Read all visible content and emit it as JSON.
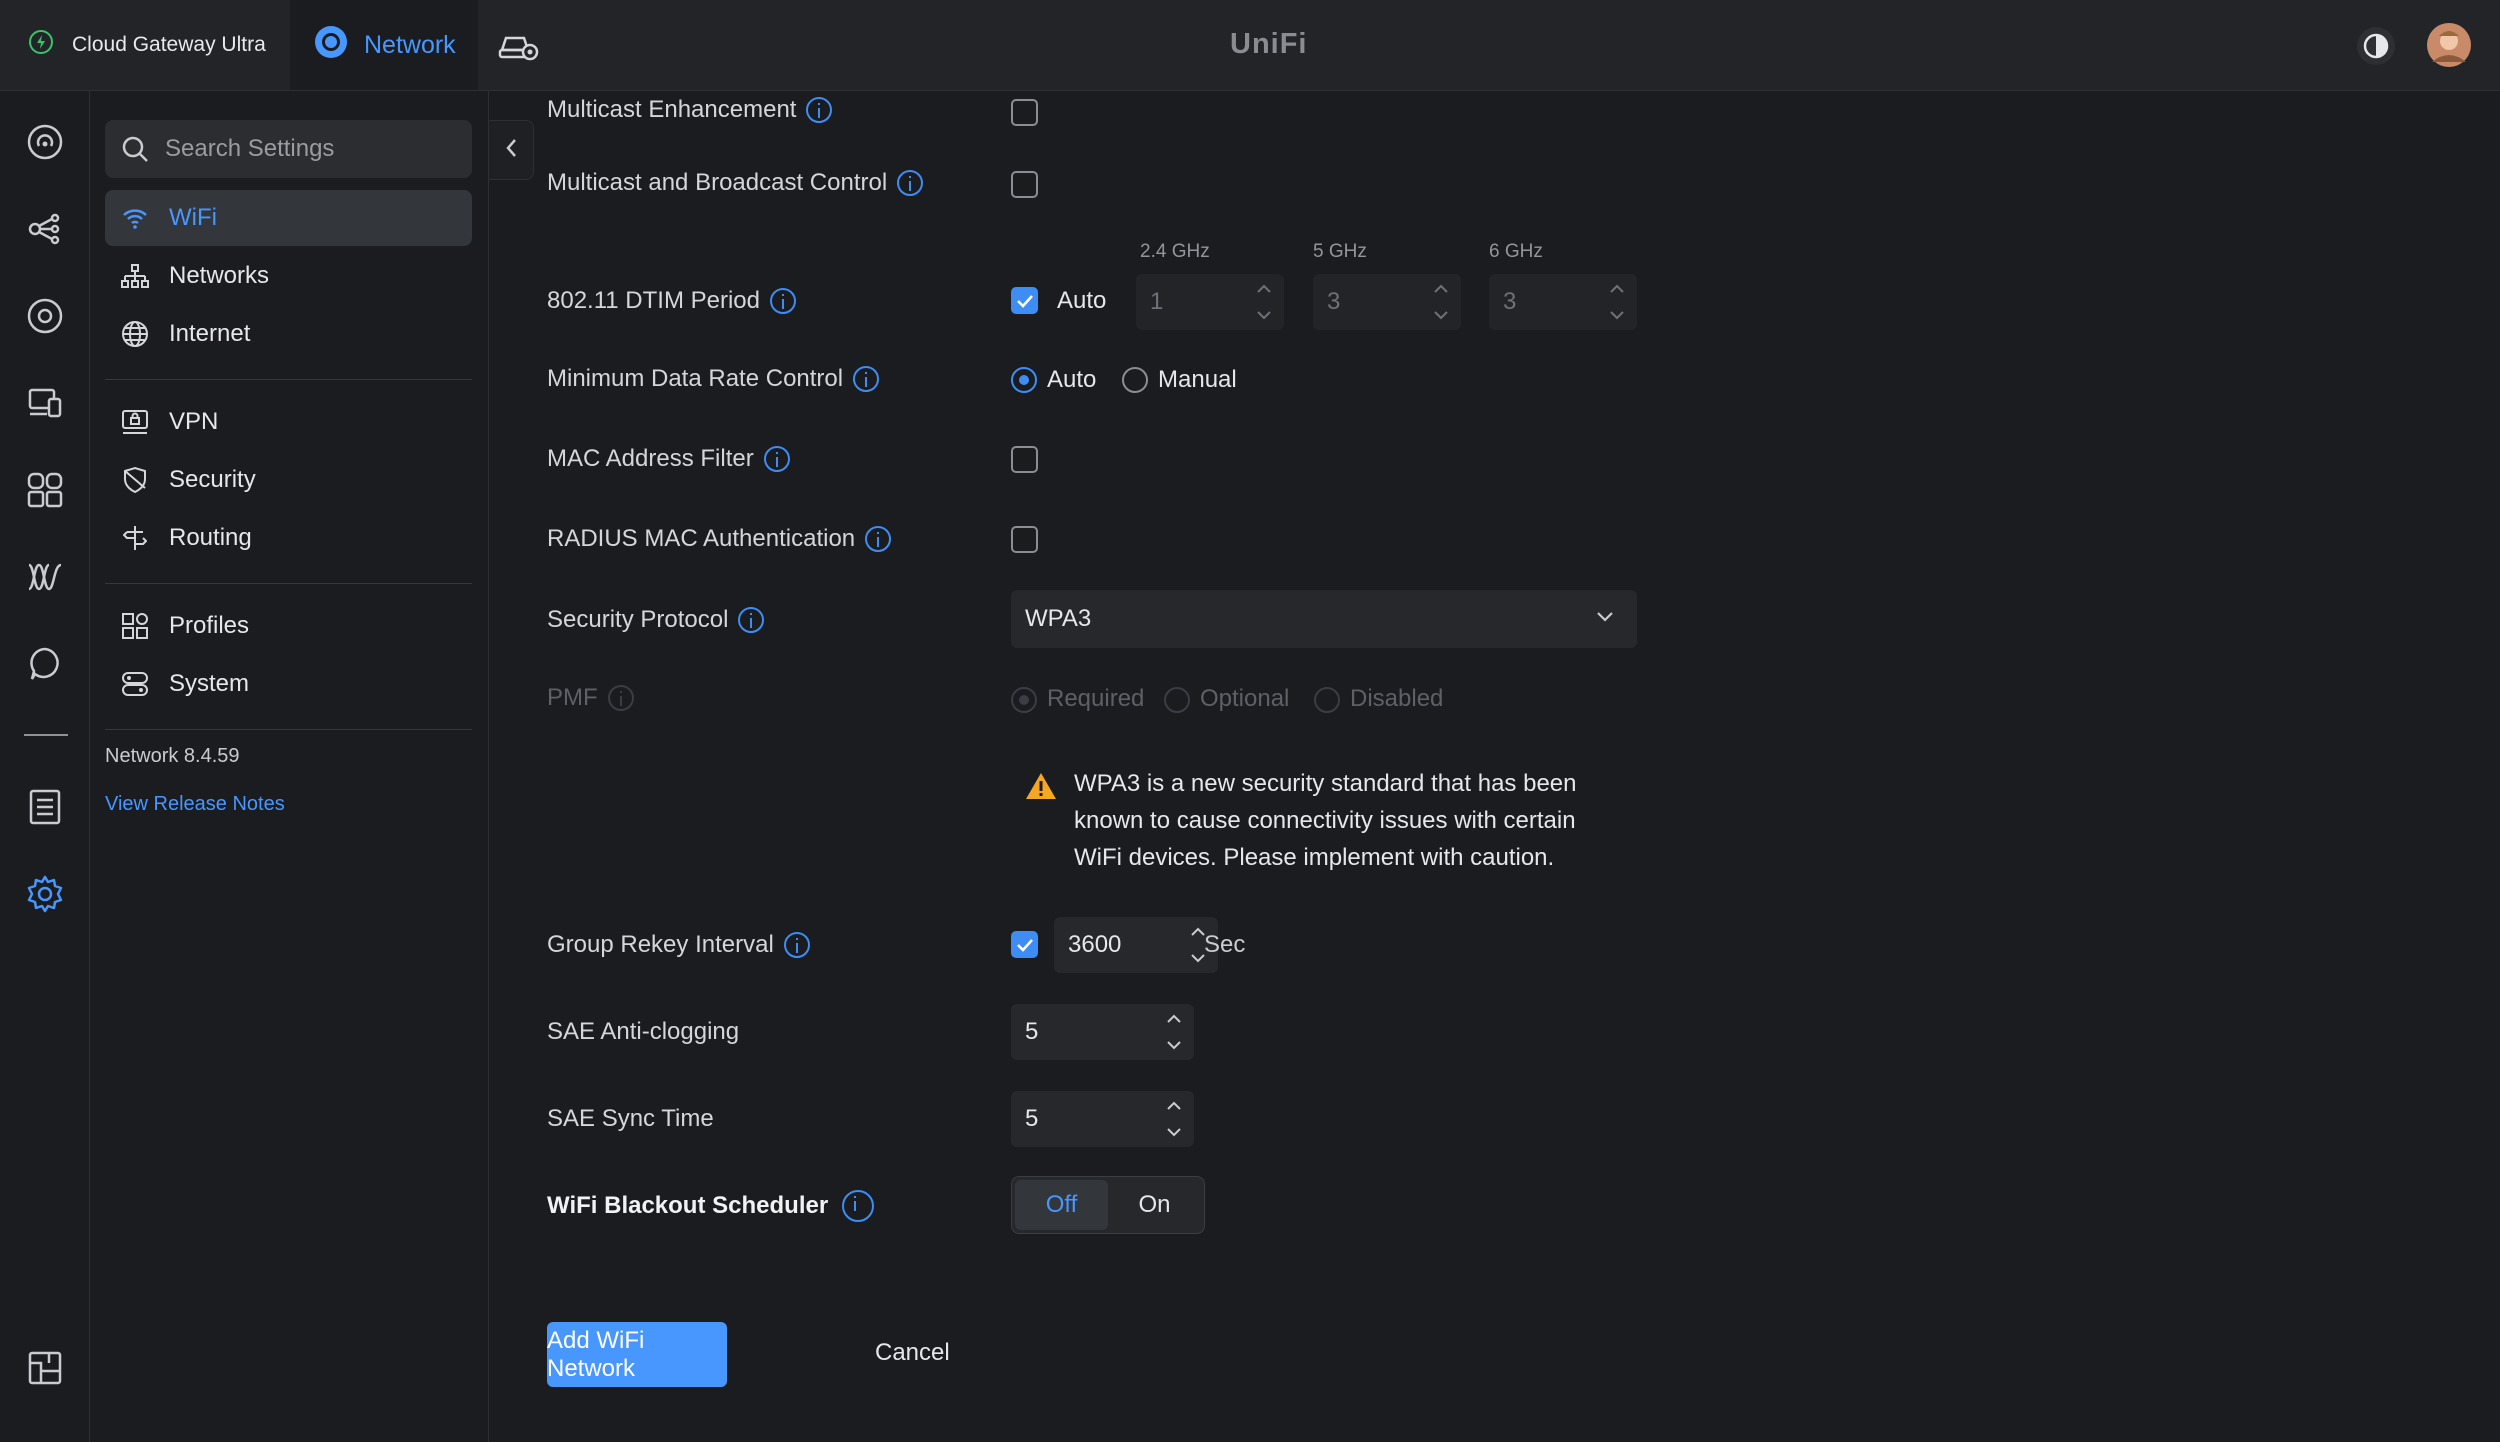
{
  "topbar": {
    "gateway_label": "Cloud Gateway Ultra",
    "app_tab_label": "Network",
    "brand": "UniFi"
  },
  "sidebar": {
    "search_placeholder": "Search Settings",
    "items": [
      {
        "label": "WiFi",
        "icon": "wifi-icon",
        "active": true
      },
      {
        "label": "Networks",
        "icon": "networks-icon"
      },
      {
        "label": "Internet",
        "icon": "globe-icon"
      },
      {
        "label": "VPN",
        "icon": "vpn-icon"
      },
      {
        "label": "Security",
        "icon": "shield-icon"
      },
      {
        "label": "Routing",
        "icon": "routing-icon"
      },
      {
        "label": "Profiles",
        "icon": "profiles-icon"
      },
      {
        "label": "System",
        "icon": "system-icon"
      }
    ],
    "version": "Network 8.4.59",
    "release_notes": "View Release Notes"
  },
  "form": {
    "multicast_enhancement": {
      "label": "Multicast Enhancement",
      "checked": false
    },
    "multicast_broadcast": {
      "label": "Multicast and Broadcast Control",
      "checked": false
    },
    "dtim": {
      "label": "802.11 DTIM Period",
      "auto_label": "Auto",
      "auto_checked": true,
      "bands": [
        {
          "name": "2.4 GHz",
          "value": "1"
        },
        {
          "name": "5 GHz",
          "value": "3"
        },
        {
          "name": "6 GHz",
          "value": "3"
        }
      ]
    },
    "min_data_rate": {
      "label": "Minimum Data Rate Control",
      "options": [
        "Auto",
        "Manual"
      ],
      "selected": "Auto"
    },
    "mac_filter": {
      "label": "MAC Address Filter",
      "checked": false
    },
    "radius_mac": {
      "label": "RADIUS MAC Authentication",
      "checked": false
    },
    "security_protocol": {
      "label": "Security Protocol",
      "value": "WPA3"
    },
    "pmf": {
      "label": "PMF",
      "options": [
        "Required",
        "Optional",
        "Disabled"
      ],
      "selected": "Required",
      "disabled": true
    },
    "warning_text": "WPA3 is a new security standard that has been known to cause connectivity issues with certain WiFi devices. Please implement with caution.",
    "group_rekey": {
      "label": "Group Rekey Interval",
      "checked": true,
      "value": "3600",
      "unit": "Sec"
    },
    "sae_anti_clogging": {
      "label": "SAE Anti-clogging",
      "value": "5"
    },
    "sae_sync_time": {
      "label": "SAE Sync Time",
      "value": "5"
    },
    "blackout": {
      "label": "WiFi Blackout Scheduler",
      "off_label": "Off",
      "on_label": "On",
      "selected": "Off"
    }
  },
  "actions": {
    "submit_label": "Add WiFi Network",
    "cancel_label": "Cancel"
  },
  "colors": {
    "accent": "#4797ff",
    "background": "#1b1c1f",
    "warning": "#f5a623"
  }
}
